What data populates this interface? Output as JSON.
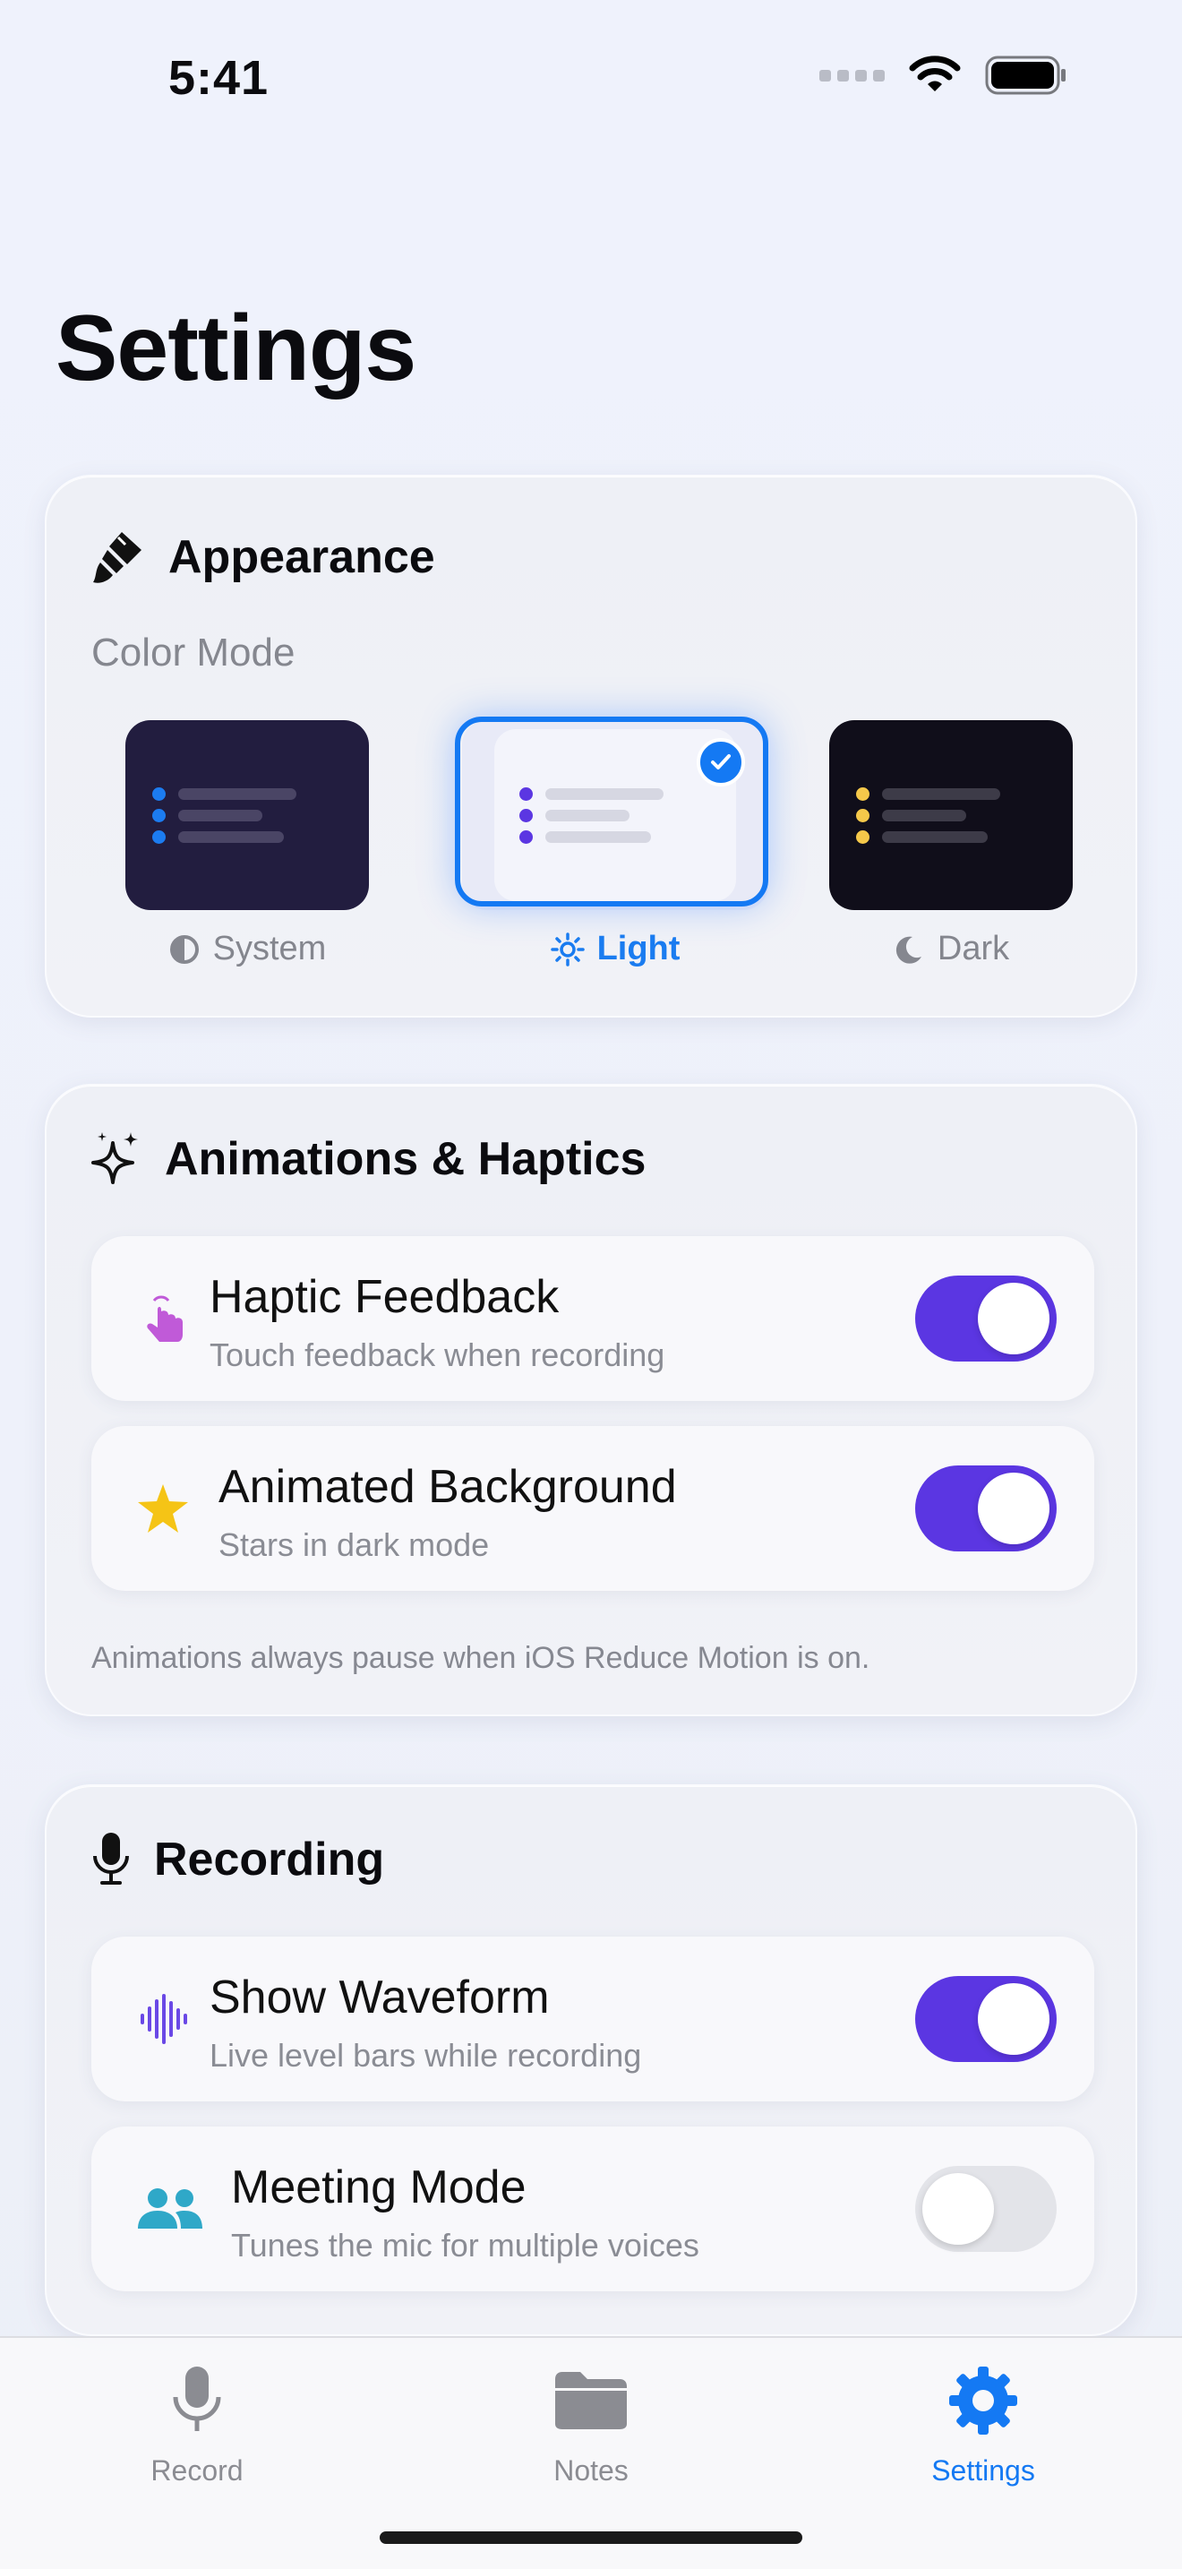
{
  "status_bar": {
    "time": "5:41"
  },
  "page": {
    "title": "Settings"
  },
  "appearance": {
    "title": "Appearance",
    "color_mode_label": "Color Mode",
    "options": [
      {
        "label": "System",
        "icon": "half-circle-icon",
        "selected": false
      },
      {
        "label": "Light",
        "icon": "sun-icon",
        "selected": true
      },
      {
        "label": "Dark",
        "icon": "moon-icon",
        "selected": false
      }
    ]
  },
  "animations": {
    "title": "Animations & Haptics",
    "rows": [
      {
        "title": "Haptic Feedback",
        "subtitle": "Touch feedback when recording",
        "icon": "hand-tap-icon",
        "on": true
      },
      {
        "title": "Animated Background",
        "subtitle": "Stars in dark mode",
        "icon": "star-icon",
        "on": true
      }
    ],
    "footnote": "Animations always pause when iOS Reduce Motion is on."
  },
  "recording": {
    "title": "Recording",
    "rows": [
      {
        "title": "Show Waveform",
        "subtitle": "Live level bars while recording",
        "icon": "waveform-icon",
        "on": true
      },
      {
        "title": "Meeting Mode",
        "subtitle": "Tunes the mic for multiple voices",
        "icon": "people-icon",
        "on": false
      }
    ]
  },
  "tab_bar": {
    "tabs": [
      {
        "label": "Record",
        "icon": "mic-icon",
        "active": false
      },
      {
        "label": "Notes",
        "icon": "folder-icon",
        "active": false
      },
      {
        "label": "Settings",
        "icon": "gear-icon",
        "active": true
      }
    ]
  },
  "colors": {
    "accent": "#5b36e2",
    "selection": "#1479f3"
  }
}
